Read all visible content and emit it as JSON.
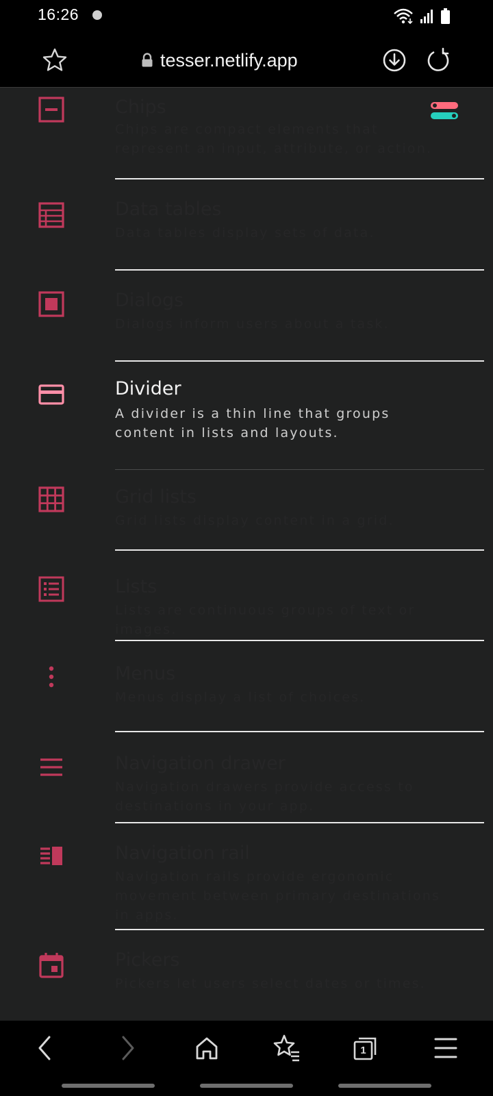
{
  "status_bar": {
    "time": "16:26"
  },
  "browser": {
    "url": "tesser.netlify.app",
    "icons": [
      "star-outline-icon",
      "lock-icon",
      "download-icon",
      "refresh-icon"
    ]
  },
  "list": [
    {
      "icon": "chip-icon",
      "title": "Chips",
      "desc": "Chips are compact elements that represent an input, attribute, or action."
    },
    {
      "icon": "data-table-icon",
      "title": "Data tables",
      "desc": "Data tables display sets of data."
    },
    {
      "icon": "dialog-icon",
      "title": "Dialogs",
      "desc": "Dialogs inform users about a task."
    },
    {
      "icon": "divider-icon",
      "title": "Divider",
      "desc": "A divider is a thin line that groups content in lists and layouts."
    },
    {
      "icon": "grid-list-icon",
      "title": "Grid lists",
      "desc": "Grid lists display content in a grid."
    },
    {
      "icon": "list-icon",
      "title": "Lists",
      "desc": "Lists are continuous groups of text or images."
    },
    {
      "icon": "menu-dots-icon",
      "title": "Menus",
      "desc": "Menus display a list of choices."
    },
    {
      "icon": "navigation-drawer-icon",
      "title": "Navigation drawer",
      "desc": "Navigation drawers provide access to destinations in your app."
    },
    {
      "icon": "navigation-rail-icon",
      "title": "Navigation rail",
      "desc": "Navigation rails provide ergonomic movement between primary destinations in apps."
    },
    {
      "icon": "calendar-icon",
      "title": "Pickers",
      "desc": "Pickers let users select dates or times."
    }
  ],
  "bottom_nav": {
    "icons": [
      "back-icon",
      "forward-icon",
      "home-icon",
      "bookmarks-icon",
      "tabs-icon",
      "menu-icon"
    ],
    "tab_count": "1"
  },
  "colors": {
    "accent": "#c0395b",
    "accent_active": "#ff8fa8",
    "background": "#202121",
    "toggle_pink": "#ff6b7d",
    "toggle_teal": "#26d0be"
  }
}
